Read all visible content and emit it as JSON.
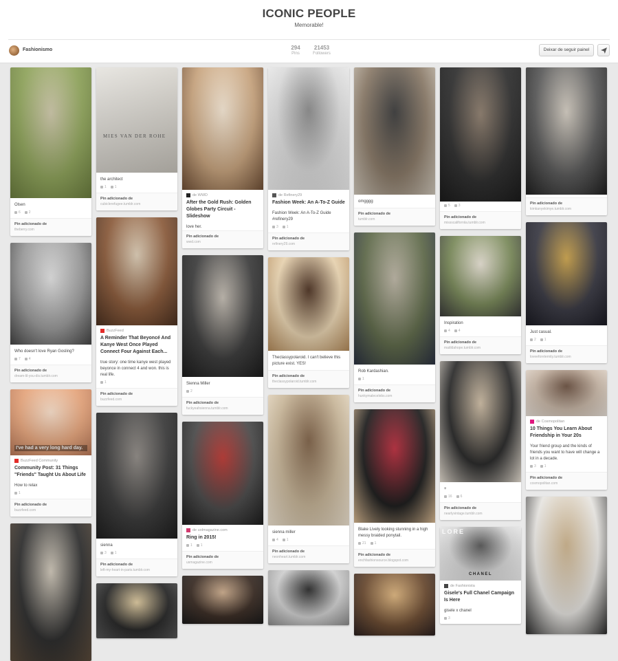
{
  "board": {
    "title": "ICONIC PEOPLE",
    "subtitle": "Memorable!",
    "owner": "Fashionismo",
    "stats": [
      {
        "value": "294",
        "label": "Pins"
      },
      {
        "value": "21453",
        "label": "Followers"
      }
    ],
    "unfollow_label": "Deixar de seguir painel"
  },
  "colors": {
    "buzzfeed": "#e32c29",
    "wwd": "#222222",
    "refinery": "#555555",
    "uol": "#d23b6f",
    "cosmo": "#e0187f",
    "fashionista": "#444444",
    "background": "#e9e9e9"
  },
  "pins": [
    {
      "id": "olsen",
      "col": 0,
      "image_h": 190,
      "image_colors": [
        "#8ea35a",
        "#c9c3a5",
        "#6a7c3e"
      ],
      "desc": "Olsen",
      "repins": "6",
      "likes": "2",
      "via_label": "Pin adicionado de",
      "via_site": "theberry.com"
    },
    {
      "id": "gosling",
      "col": 0,
      "image_h": 148,
      "image_colors": [
        "#9a9a9a",
        "#dcdcdc",
        "#444444"
      ],
      "desc": "Who doesn't love Ryan Gosling?",
      "repins": "7",
      "likes": "4",
      "via_label": "Pin adicionado de",
      "via_site": "dream-lil-you-dis.tumblr.com"
    },
    {
      "id": "friends",
      "col": 0,
      "image_h": 96,
      "image_colors": [
        "#e6a57c",
        "#f3d9c4",
        "#b87858"
      ],
      "overlay": "I've had a very long hard day.",
      "source": "BuzzFeed Community",
      "source_icon": "buzzfeed",
      "title": "Community Post: 31 Things \"Friends\" Taught Us About Life",
      "desc": "How to relax",
      "repins": "1",
      "likes": "",
      "via_label": "Pin adicionado de",
      "via_site": "buzzfeed.com"
    },
    {
      "id": "stairs",
      "col": 0,
      "image_h": 200,
      "image_colors": [
        "#2d2d2d",
        "#c9c1b3",
        "#5a4a3a"
      ]
    },
    {
      "id": "mies",
      "col": 1,
      "image_h": 153,
      "image_colors": [
        "#e6e4df",
        "#d7d4ce",
        "#c7c3bb"
      ],
      "overlay": "MIES VAN DER ROHE",
      "desc": "the architect",
      "repins": "1",
      "likes": "1",
      "via_label": "Pin adicionado de",
      "via_site": "cubiclerefugee.tumblr.com"
    },
    {
      "id": "connect4",
      "col": 1,
      "image_h": 157,
      "image_colors": [
        "#8b5b3b",
        "#d9c9b2",
        "#4a3020"
      ],
      "source": "BuzzFeed",
      "source_icon": "buzzfeed",
      "title": "A Reminder That Beyoncé And Kanye West Once Played Connect Four Against Each...",
      "desc": "true story: one time kanye west played beyonce in connect 4 and won. this is real life.",
      "repins": "1",
      "likes": "",
      "via_label": "Pin adicionado de",
      "via_site": "buzzfeed.com"
    },
    {
      "id": "sienna-coat",
      "col": 1,
      "image_h": 183,
      "image_colors": [
        "#3a3a3a",
        "#8a8580",
        "#1d1d1d"
      ],
      "desc": "sienna",
      "repins": "3",
      "likes": "1",
      "via_label": "Pin adicionado de",
      "via_site": "left-my-heart-in-paris.tumblr.com"
    },
    {
      "id": "blonde-wave",
      "col": 1,
      "image_h": 80,
      "image_colors": [
        "#262626",
        "#d8c49a",
        "#555555"
      ]
    },
    {
      "id": "goldrush",
      "col": 2,
      "image_h": 178,
      "image_colors": [
        "#c8a47e",
        "#f0e2cf",
        "#6e4e35"
      ],
      "source": "de WWD",
      "source_icon": "wwd",
      "title": "After the Gold Rush: Golden Globes Party Circuit - Slideshow",
      "desc": "love her.",
      "via_label": "Pin adicionado de",
      "via_site": "wwd.com"
    },
    {
      "id": "sienna-miller-1",
      "col": 2,
      "image_h": 177,
      "image_colors": [
        "#3c3c3c",
        "#bdb6ac",
        "#1b1b1b"
      ],
      "desc": "Sienna Miller",
      "repins": "2",
      "likes": "",
      "via_label": "Pin adicionado de",
      "via_site": "fuckyeahsienna.tumblr.com"
    },
    {
      "id": "ring",
      "col": 2,
      "image_h": 150,
      "image_colors": [
        "#4a4a4a",
        "#b4342f",
        "#1c1c1c"
      ],
      "source": "de uolmagazine.com",
      "source_icon": "uol",
      "title": "Ring in 2015!",
      "repins": "1",
      "likes": "1",
      "via_label": "Pin adicionado de",
      "via_site": "usmagazine.com"
    },
    {
      "id": "olivia",
      "col": 2,
      "image_h": 70,
      "image_colors": [
        "#3a2c24",
        "#c9a98a",
        "#1a1a1a"
      ]
    },
    {
      "id": "beckham",
      "col": 3,
      "image_h": 178,
      "image_colors": [
        "#dcdcdc",
        "#8a8a8a",
        "#efefef"
      ],
      "source": "de Refinery29",
      "source_icon": "refinery",
      "title": "Fashion Week: An A-To-Z Guide",
      "desc": "Fashion Week: An A-To-Z Guide #refinery29",
      "repins": "3",
      "likes": "1",
      "via_label": "Pin adicionado de",
      "via_site": "refinery29.com"
    },
    {
      "id": "polaroid",
      "col": 3,
      "image_h": 136,
      "image_colors": [
        "#e8d3b0",
        "#4a3020",
        "#b38a5a"
      ],
      "desc": "Theclassypolaroid. I can't believe this picture exist. YES!",
      "repins": "",
      "likes": "",
      "via_label": "Pin adicionado de",
      "via_site": "theclassypolaroid.tumblr.com"
    },
    {
      "id": "sienna-miller-2",
      "col": 3,
      "image_h": 190,
      "image_colors": [
        "#c9b79a",
        "#7a5e44",
        "#efe4d2"
      ],
      "desc": "sienna miller",
      "repins": "4",
      "likes": "1",
      "via_label": "Pin adicionado de",
      "via_site": "neonheart.tumblr.com"
    },
    {
      "id": "rihanna",
      "col": 3,
      "image_h": 80,
      "image_colors": [
        "#d0d0d0",
        "#2a2a2a",
        "#8a8a8a"
      ]
    },
    {
      "id": "kanye-street",
      "col": 4,
      "image_h": 185,
      "image_colors": [
        "#8a7a68",
        "#3a3a3a",
        "#cfc7ba"
      ],
      "desc": "omgggg",
      "repins": "",
      "likes": "",
      "via_label": "Pin adicionado de",
      "via_site": "tumblr.com"
    },
    {
      "id": "rob",
      "col": 4,
      "image_h": 192,
      "image_colors": [
        "#5f6a4a",
        "#b7b0a0",
        "#2a3040"
      ],
      "desc": "Rob Kardashian.",
      "repins": "1",
      "likes": "",
      "via_label": "Pin adicionado de",
      "via_site": "hunkymalecelebs.com"
    },
    {
      "id": "blake",
      "col": 4,
      "image_h": 165,
      "image_colors": [
        "#1d1d1d",
        "#b42a3a",
        "#d8b992"
      ],
      "desc": "Blake Lively looking stunning in a high messy braided ponytail.",
      "repins": "21",
      "likes": "1",
      "via_label": "Pin adicionado de",
      "via_site": "enchfashionsource.blogspot.com"
    },
    {
      "id": "blake-2",
      "col": 4,
      "image_h": 90,
      "image_colors": [
        "#6a4a30",
        "#d8b07a",
        "#2a2020"
      ]
    },
    {
      "id": "kim-gif",
      "col": 5,
      "image_h": 195,
      "image_colors": [
        "#2e2e2e",
        "#8a7a6a",
        "#1b1b1b"
      ],
      "desc": "",
      "repins": "5",
      "likes": "3",
      "via_label": "Pin adicionado de",
      "via_site": "missscaliforniia.tumblr.com"
    },
    {
      "id": "inspiration",
      "col": 5,
      "image_h": 117,
      "image_colors": [
        "#7a8a5a",
        "#e3ddd0",
        "#3a3a3a"
      ],
      "desc": "Inspiration",
      "repins": "4",
      "likes": "4",
      "via_label": "Pin adicionado de",
      "via_site": "matildahope.tumblr.com"
    },
    {
      "id": "vintage",
      "col": 5,
      "image_h": 176,
      "image_colors": [
        "#2a2a2a",
        "#c9b8a0",
        "#e8e0d4"
      ],
      "desc": "+",
      "repins": "16",
      "likes": "6",
      "via_label": "Pin adicionado de",
      "via_site": "nearlyvintage.tumblr.com"
    },
    {
      "id": "chanel",
      "col": 5,
      "image_h": 78,
      "image_colors": [
        "#d8d8d8",
        "#555555",
        "#f0f0f0"
      ],
      "overlay": "CHANEL",
      "overlay2": "LORE",
      "source": "de Fashionista",
      "source_icon": "fashionista",
      "title": "Gisele's Full Chanel Campaign Is Here",
      "desc": "gisele x chanel",
      "repins": "3",
      "likes": ""
    },
    {
      "id": "kimye",
      "col": 6,
      "image_h": 185,
      "image_colors": [
        "#5a5a5a",
        "#cfc8bd",
        "#1f1f1f"
      ],
      "desc": "",
      "repins": "",
      "likes": "",
      "via_label": "Pin adicionado de",
      "via_site": "kimkanyekimye.tumblr.com"
    },
    {
      "id": "grammys",
      "col": 6,
      "image_h": 150,
      "image_colors": [
        "#3a3a44",
        "#c9a14a",
        "#1a1a22"
      ],
      "desc": "Just casual.",
      "repins": "2",
      "likes": "1",
      "via_label": "Pin adicionado de",
      "via_site": "loveeforeternity.tumblr.com"
    },
    {
      "id": "friendship",
      "col": 6,
      "image_h": 67,
      "image_colors": [
        "#c9b8a8",
        "#6a5040",
        "#e8e0d8"
      ],
      "source": "de Cosmopolitan",
      "source_icon": "cosmo",
      "title": "10 Things You Learn About Friendship in Your 20s",
      "desc": "Your friend group and the kinds of friends you want to have will change a lot in a decade.",
      "repins": "3",
      "likes": "1",
      "via_label": "Pin adicionado de",
      "via_site": "cosmopolitan.com"
    },
    {
      "id": "karlie",
      "col": 6,
      "image_h": 200,
      "image_colors": [
        "#e8e6e2",
        "#c9b08a",
        "#2a2a2a"
      ]
    }
  ]
}
